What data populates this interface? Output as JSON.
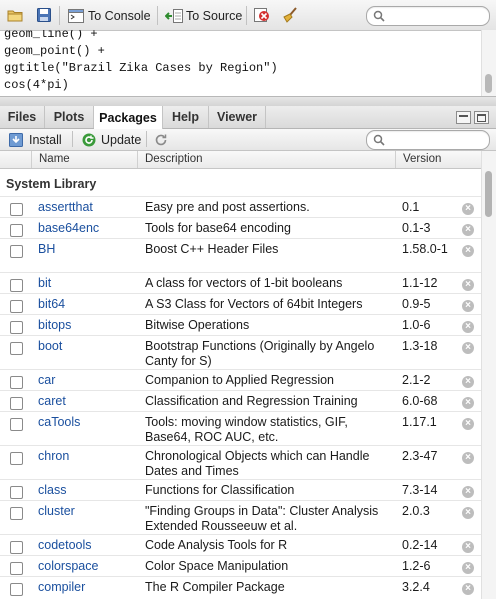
{
  "history": {
    "toolbar": {
      "to_console": "To Console",
      "to_source": "To Source",
      "search_placeholder": ""
    },
    "lines": [
      "geom_line() +",
      "geom_point() +",
      "ggtitle(\"Brazil Zika Cases by Region\")",
      "cos(4*pi)"
    ]
  },
  "tabs": [
    {
      "label": "Files",
      "active": false
    },
    {
      "label": "Plots",
      "active": false
    },
    {
      "label": "Packages",
      "active": true
    },
    {
      "label": "Help",
      "active": false
    },
    {
      "label": "Viewer",
      "active": false
    }
  ],
  "packages_toolbar": {
    "install": "Install",
    "update": "Update",
    "search_placeholder": ""
  },
  "columns": {
    "name": "Name",
    "description": "Description",
    "version": "Version"
  },
  "section": "System Library",
  "packages": [
    {
      "name": "assertthat",
      "description": "Easy pre and post assertions.",
      "version": "0.1"
    },
    {
      "name": "base64enc",
      "description": "Tools for base64 encoding",
      "version": "0.1‑3"
    },
    {
      "name": "BH",
      "description": "Boost C++ Header Files",
      "version": "1.58.0‑1"
    },
    {
      "name": "bit",
      "description": "A class for vectors of 1‑bit booleans",
      "version": "1.1‑12"
    },
    {
      "name": "bit64",
      "description": "A S3 Class for Vectors of 64bit Integers",
      "version": "0.9‑5"
    },
    {
      "name": "bitops",
      "description": "Bitwise Operations",
      "version": "1.0‑6"
    },
    {
      "name": "boot",
      "description": "Bootstrap Functions (Originally by Angelo Canty for S)",
      "version": "1.3‑18"
    },
    {
      "name": "car",
      "description": "Companion to Applied Regression",
      "version": "2.1‑2"
    },
    {
      "name": "caret",
      "description": "Classification and Regression Training",
      "version": "6.0‑68"
    },
    {
      "name": "caTools",
      "description": "Tools: moving window statistics, GIF, Base64, ROC AUC, etc.",
      "version": "1.17.1"
    },
    {
      "name": "chron",
      "description": "Chronological Objects which can Handle Dates and Times",
      "version": "2.3‑47"
    },
    {
      "name": "class",
      "description": "Functions for Classification",
      "version": "7.3‑14"
    },
    {
      "name": "cluster",
      "description": "\"Finding Groups in Data\": Cluster Analysis Extended Rousseeuw et al.",
      "version": "2.0.3"
    },
    {
      "name": "codetools",
      "description": "Code Analysis Tools for R",
      "version": "0.2‑14"
    },
    {
      "name": "colorspace",
      "description": "Color Space Manipulation",
      "version": "1.2‑6"
    },
    {
      "name": "compiler",
      "description": "The R Compiler Package",
      "version": "3.2.4"
    }
  ],
  "colors": {
    "package_link": "#1a4f9e",
    "remove_icon": "#bdbdbd"
  }
}
